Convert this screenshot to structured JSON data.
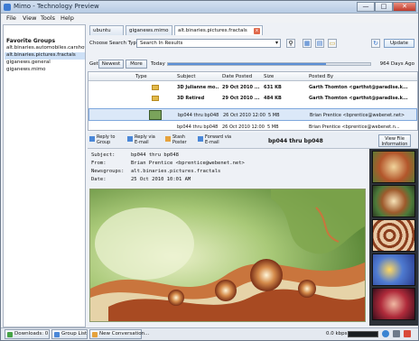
{
  "app": {
    "title": "Mimo - Technology Preview"
  },
  "window_controls": {
    "minimize": "—",
    "maximize": "□",
    "close": "✕"
  },
  "menu": [
    "File",
    "View",
    "Tools",
    "Help"
  ],
  "sidebar": {
    "header": "Favorite Groups",
    "items": [
      {
        "label": "alt.binaries.automobiles.carshows",
        "selected": false
      },
      {
        "label": "alt.binaries.pictures.fractals",
        "selected": true
      },
      {
        "label": "giganews.general",
        "selected": false
      },
      {
        "label": "giganews.mimo",
        "selected": false
      }
    ]
  },
  "tabs": [
    {
      "label": "ubuntu",
      "active": false
    },
    {
      "label": "giganews.mimo",
      "active": false
    },
    {
      "label": "alt.binaries.pictures.fractals",
      "active": true,
      "close": "x"
    }
  ],
  "search": {
    "label": "Choose Search Type:",
    "value": "Search In Results",
    "update_button": "Update"
  },
  "get": {
    "label": "Get:",
    "newest": "Newest",
    "more": "More",
    "today": "Today",
    "days_ago": "964 Days Ago",
    "progress": 0.78
  },
  "grid": {
    "columns": [
      "Type",
      "Subject",
      "Date Posted",
      "Size",
      "Posted By"
    ],
    "rows": [
      {
        "subject": "3D Julianne mo...",
        "date": "29 Oct 2010 ...",
        "size": "631 KB",
        "posted_by": "Garth Thomton <garthst@paradise.k...",
        "bold": true,
        "selected": false
      },
      {
        "subject": "3D Retired",
        "date": "29 Oct 2010 ...",
        "size": "484 KB",
        "posted_by": "Garth Thomton <garthst@paradise.k...",
        "bold": true,
        "selected": false
      },
      {
        "subject": "bp044 thru bp048",
        "date": "26 Oct 2010 12:00 ...",
        "size": "5 MB",
        "posted_by": "Brian Prentice <bprentice@webenet.net>",
        "bold": false,
        "selected": true
      },
      {
        "subject": "bp044 thru bp048",
        "date": "26 Oct 2010 12:00 ...",
        "size": "5 MB",
        "posted_by": "Brian Prentice <bprentice@webenet.n...",
        "bold": false,
        "selected": false
      }
    ]
  },
  "actions": {
    "reply_group": [
      "Reply to",
      "Group"
    ],
    "reply_email": [
      "Reply via",
      "E-mail"
    ],
    "stash": [
      "Stash",
      "Poster"
    ],
    "forward": [
      "Forward via",
      "E-mail"
    ],
    "subject_header": "bp044 thru bp048",
    "view_info": [
      "View File",
      "Information"
    ]
  },
  "message": {
    "subject_key": "Subject:",
    "subject": "bp044 thru bp048",
    "from_key": "From:",
    "from": "Brian Prentice <bprentice@webenet.net>",
    "newsgroups_key": "Newsgroups:",
    "newsgroups": "alt.binaries.pictures.fractals",
    "date_key": "Date:",
    "date": "25 Oct 2010 10:01 AM"
  },
  "status": {
    "downloads": "Downloads: 0",
    "group_list": "Group List",
    "new_conversation": "New Conversation...",
    "speed": "0.0 kbps"
  },
  "colors": {
    "accent": "#3d7bd3",
    "selection": "#dbe8f8",
    "close": "#c0392b"
  },
  "icons": [
    "app-icon",
    "folder-icon",
    "image-icon",
    "reply-icon",
    "forward-icon",
    "stash-icon",
    "search-go-icon",
    "view-grid-icon",
    "download-icon",
    "refresh-icon"
  ]
}
